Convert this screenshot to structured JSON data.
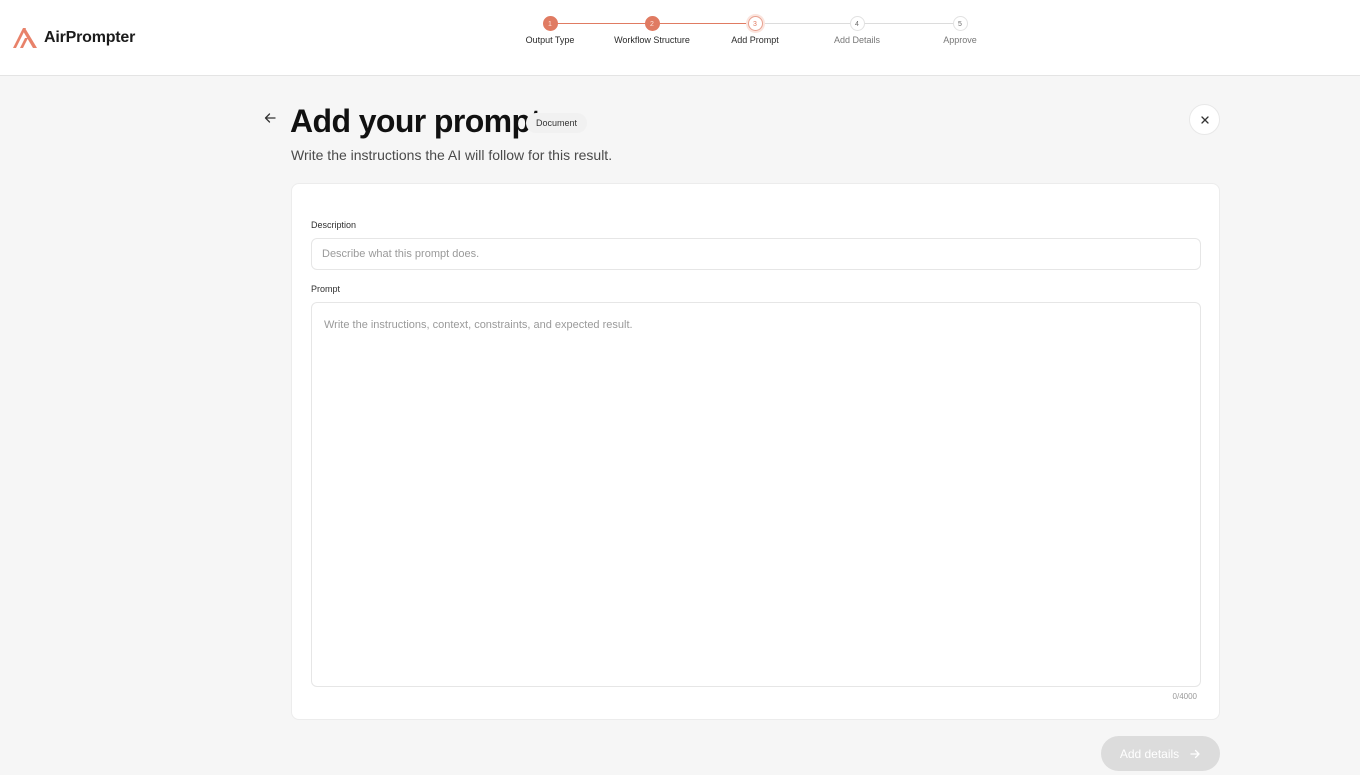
{
  "brand": {
    "name": "AirPrompter",
    "logo_icon": "airprompter-logo-icon",
    "accent": "#e07b62"
  },
  "stepper": {
    "steps": [
      {
        "number": "1",
        "label": "Output Type",
        "state": "done"
      },
      {
        "number": "2",
        "label": "Workflow Structure",
        "state": "done"
      },
      {
        "number": "3",
        "label": "Add Prompt",
        "state": "current"
      },
      {
        "number": "4",
        "label": "Add Details",
        "state": "upcoming"
      },
      {
        "number": "5",
        "label": "Approve",
        "state": "upcoming"
      }
    ]
  },
  "header": {
    "back_icon": "arrow-left-icon",
    "title": "Add your prompt",
    "badge": "Document",
    "subtitle": "Write the instructions the AI will follow for this result.",
    "close_icon": "close-icon"
  },
  "form": {
    "description": {
      "label": "Description",
      "value": "",
      "placeholder": "Describe what this prompt does."
    },
    "prompt": {
      "label": "Prompt",
      "value": "",
      "placeholder": "Write the instructions, context, constraints, and expected result."
    },
    "char_count": "0/4000"
  },
  "footer": {
    "next_label": "Add details",
    "next_icon": "arrow-right-icon",
    "disabled": true
  }
}
